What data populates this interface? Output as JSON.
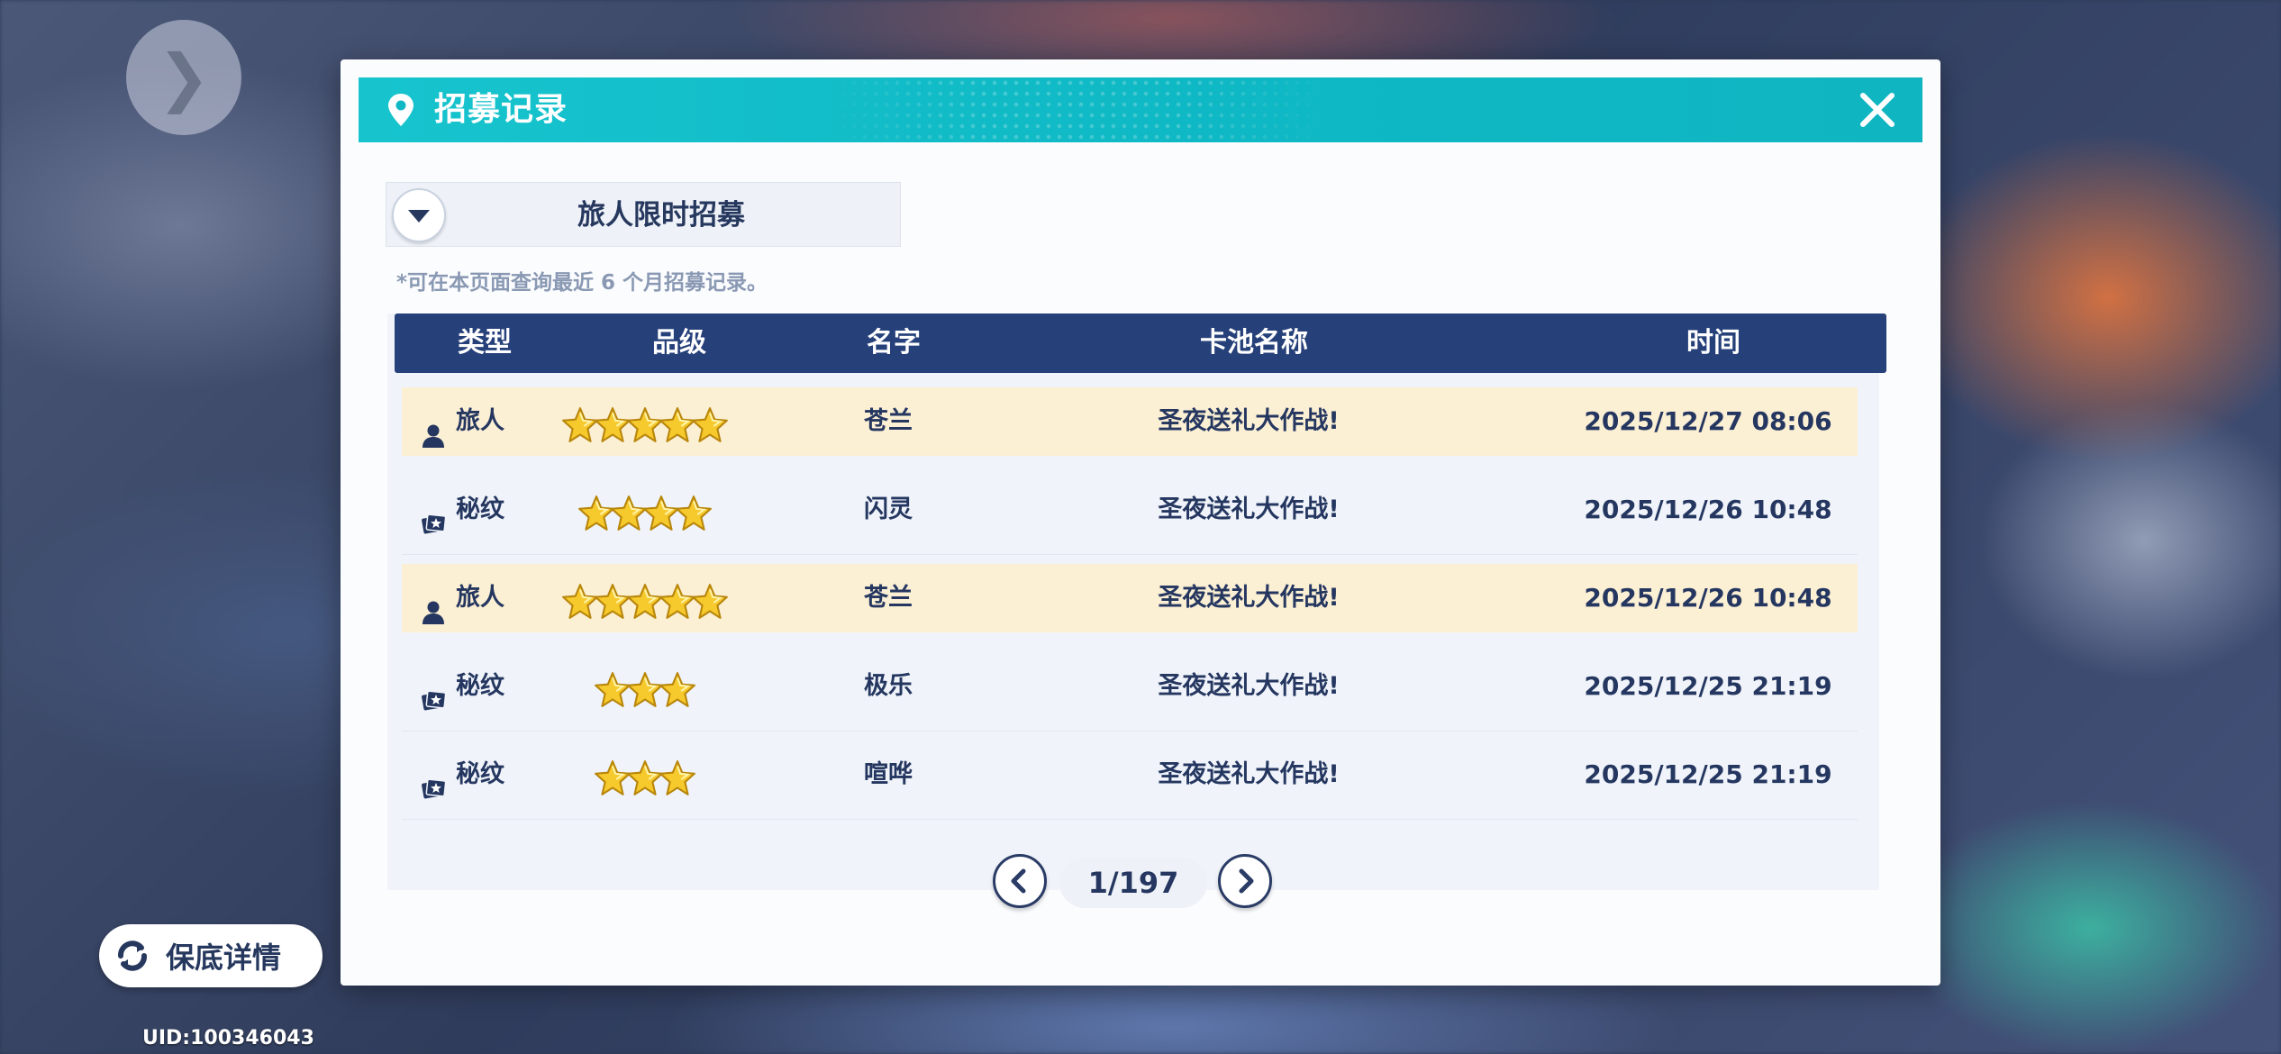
{
  "modal": {
    "title": "招募记录",
    "pool_selector": "旅人限时招募",
    "note": "*可在本页面查询最近 6 个月招募记录。"
  },
  "table": {
    "headers": [
      "类型",
      "品级",
      "名字",
      "卡池名称",
      "时间"
    ],
    "rows": [
      {
        "type": "旅人",
        "type_icon": "person-icon",
        "rarity": 5,
        "name": "苍兰",
        "pool": "圣夜送礼大作战!",
        "time": "2025/12/27 08:06",
        "highlight": true
      },
      {
        "type": "秘纹",
        "type_icon": "rune-card-icon",
        "rarity": 4,
        "name": "闪灵",
        "pool": "圣夜送礼大作战!",
        "time": "2025/12/26 10:48",
        "highlight": false
      },
      {
        "type": "旅人",
        "type_icon": "person-icon",
        "rarity": 5,
        "name": "苍兰",
        "pool": "圣夜送礼大作战!",
        "time": "2025/12/26 10:48",
        "highlight": true
      },
      {
        "type": "秘纹",
        "type_icon": "rune-card-icon",
        "rarity": 3,
        "name": "极乐",
        "pool": "圣夜送礼大作战!",
        "time": "2025/12/25 21:19",
        "highlight": false
      },
      {
        "type": "秘纹",
        "type_icon": "rune-card-icon",
        "rarity": 3,
        "name": "喧哗",
        "pool": "圣夜送礼大作战!",
        "time": "2025/12/25 21:19",
        "highlight": false
      }
    ]
  },
  "pager": {
    "indicator": "1/197"
  },
  "pity_button": {
    "label": "保底详情"
  },
  "uid": "UID:100346043",
  "colors": {
    "title_bar": "#10b8c4",
    "table_header": "#26407a",
    "highlight_row": "#fbefd4",
    "text": "#253760"
  }
}
